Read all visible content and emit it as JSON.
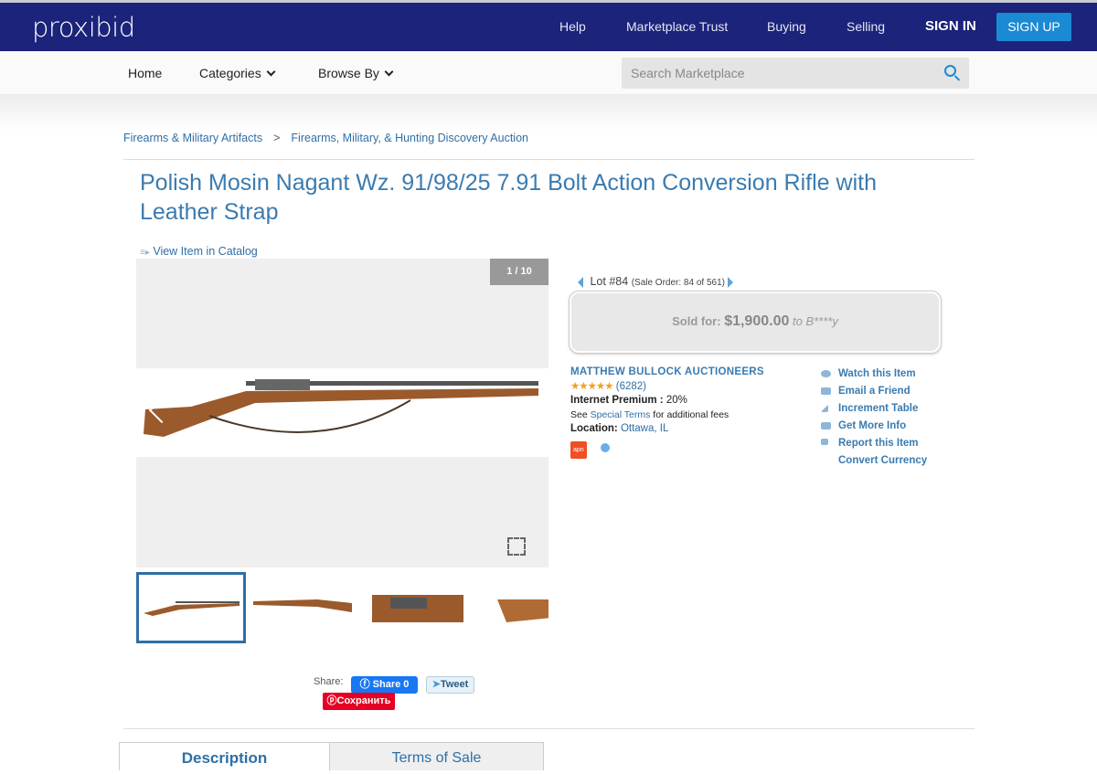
{
  "header": {
    "logo": "proxibid",
    "links": [
      "Help",
      "Marketplace Trust",
      "Buying",
      "Selling"
    ],
    "sign_in": "SIGN IN",
    "sign_up": "SIGN UP"
  },
  "subnav": {
    "home": "Home",
    "categories": "Categories",
    "browse": "Browse By",
    "search_placeholder": "Search Marketplace"
  },
  "breadcrumb": [
    "Firearms & Military Artifacts",
    ">",
    "Firearms, Military, & Hunting Discovery Auction"
  ],
  "title": "Polish Mosin Nagant Wz. 91/98/25 7.91 Bolt Action Conversion Rifle with Leather Strap",
  "view_catalog": "View Item in Catalog",
  "gallery": {
    "counter": "1 / 10"
  },
  "lot": {
    "label": "Lot #84",
    "sale_order": "(Sale Order: 84 of 561)"
  },
  "sold": {
    "label": "Sold for:",
    "amount": "$1,900.00",
    "to": "to B****y"
  },
  "seller": {
    "name": "MATTHEW BULLOCK AUCTIONEERS",
    "stars": "★★★★★",
    "rating_count": "(6282)",
    "premium_label": "Internet Premium :",
    "premium": "20%",
    "see": "See",
    "special_terms": "Special Terms",
    "fees": "for additional fees",
    "location_label": "Location:",
    "location": "Ottawa, IL",
    "badge": "apn"
  },
  "actions": [
    "Watch this Item",
    "Email a Friend",
    "Increment Table",
    "Get More Info",
    "Report this Item",
    "Convert Currency"
  ],
  "share": {
    "label": "Share:",
    "facebook": "Share 0",
    "twitter": "Tweet",
    "pinterest": "Сохранить"
  },
  "tabs": [
    "Description",
    "Terms of Sale"
  ]
}
